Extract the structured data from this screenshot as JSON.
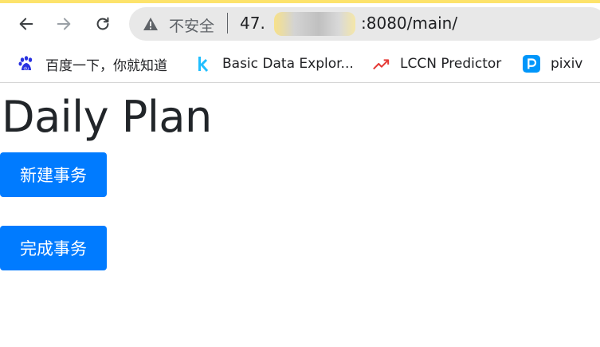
{
  "browser": {
    "security_label": "不安全",
    "url_prefix": "47.",
    "url_suffix": ":8080/main/"
  },
  "bookmarks": [
    {
      "label": "百度一下，你就知道",
      "icon": "baidu-paw-icon",
      "color": "#2932e1"
    },
    {
      "label": "Basic Data Explor...",
      "icon": "kaggle-k-icon",
      "color": "#20beff"
    },
    {
      "label": "LCCN Predictor",
      "icon": "trend-arrow-icon",
      "color": "#e53935"
    },
    {
      "label": "pixiv",
      "icon": "pixiv-p-icon",
      "color": "#0096fa"
    }
  ],
  "page": {
    "title": "Daily Plan",
    "new_task_label": "新建事务",
    "complete_task_label": "完成事务"
  },
  "colors": {
    "primary_button": "#007bff",
    "top_accent": "#fde36b"
  }
}
